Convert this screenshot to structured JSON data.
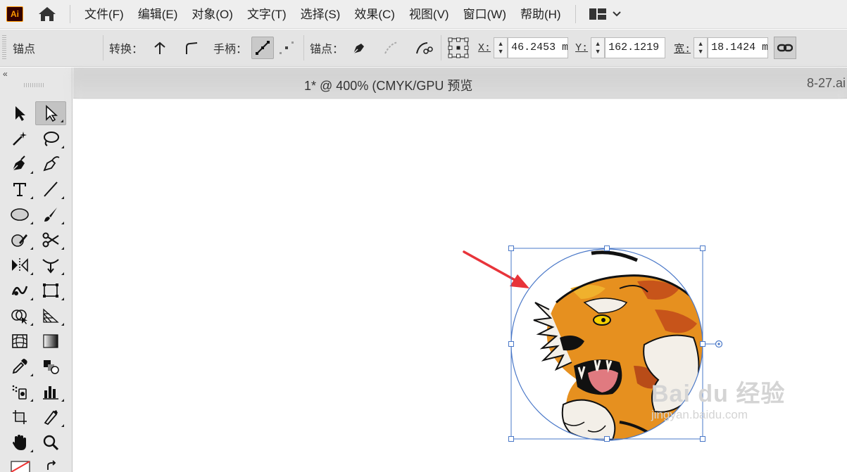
{
  "app": {
    "logo": "Ai"
  },
  "menu": [
    "文件(F)",
    "编辑(E)",
    "对象(O)",
    "文字(T)",
    "选择(S)",
    "效果(C)",
    "视图(V)",
    "窗口(W)",
    "帮助(H)"
  ],
  "control_bar": {
    "context": "锚点",
    "convert_label": "转换：",
    "handles_label": "手柄：",
    "anchors_label": "锚点：",
    "x_label": "X:",
    "x_value": "46.2453 m",
    "y_label": "Y:",
    "y_value": "162.1219",
    "w_label": "宽:",
    "w_value": "18.1424 m"
  },
  "document": {
    "title": "1* @ 400% (CMYK/GPU 预览",
    "file": "8-27.ai"
  },
  "tools": [
    "selection-tool",
    "direct-selection-tool",
    "magic-wand-tool",
    "lasso-tool",
    "pen-tool",
    "curvature-tool",
    "type-tool",
    "line-tool",
    "ellipse-tool",
    "paintbrush-tool",
    "shaper-tool",
    "scissors-tool",
    "rotate-tool",
    "width-tool",
    "warp-tool",
    "free-transform-tool",
    "shape-builder-tool",
    "perspective-grid-tool",
    "mesh-tool",
    "gradient-tool",
    "eyedropper-tool",
    "blend-tool",
    "symbol-sprayer-tool",
    "column-graph-tool",
    "artboard-tool",
    "slice-tool",
    "hand-tool",
    "zoom-tool"
  ],
  "watermark": {
    "brand": "Bai du 经验",
    "url": "jingyan.baidu.com"
  },
  "colors": {
    "accent_arrow": "#e8343a",
    "selection": "#4a78c8",
    "brand_orange": "#ff9a00"
  }
}
